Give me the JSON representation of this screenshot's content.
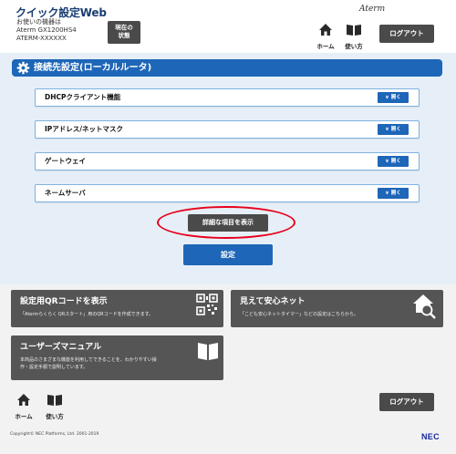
{
  "header": {
    "app_title": "クイック設定Web",
    "device_label": "お使いの機器は",
    "device_model": "Aterm GX1200HS4",
    "device_name": "ATERM-XXXXXX",
    "status_button_line1": "現在の",
    "status_button_line2": "状態",
    "logo": "Aterm",
    "home_label": "ホーム",
    "help_label": "使い方",
    "logout_label": "ログアウト"
  },
  "main": {
    "section_title": "接続先設定(ローカルルータ)",
    "open_label": "開く",
    "rows": [
      {
        "label": "DHCPクライアント機能"
      },
      {
        "label": "IPアドレス/ネットマスク"
      },
      {
        "label": "ゲートウェイ"
      },
      {
        "label": "ネームサーバ"
      }
    ],
    "detail_button": "詳細な項目を表示",
    "set_button": "設定"
  },
  "cards": {
    "qr": {
      "title": "設定用QRコードを表示",
      "desc": "「Atermらくらく QRスタート」用のQRコードを作成できます。",
      "icon": "qr-code-icon"
    },
    "safety": {
      "title": "見えて安心ネット",
      "desc": "「こども安心ネットタイマー」などの設定はこちらから。",
      "icon": "house-magnifier-icon"
    },
    "manual": {
      "title": "ユーザーズマニュアル",
      "desc_line1": "本商品のさまざまな機能を利用してできることを、わかりやすい操",
      "desc_line2": "作・設定手順で説明しています。",
      "icon": "book-icon"
    }
  },
  "footer": {
    "home_label": "ホーム",
    "help_label": "使い方",
    "logout_label": "ログアウト",
    "copyright": "Copyright© NEC Platforms, Ltd. 2001-2019",
    "brand": "NEC"
  },
  "colors": {
    "accent_blue": "#1e66b8",
    "dark_button": "#4a4a4a",
    "panel_bg": "#e6eff7",
    "highlight_red": "#e8001c"
  }
}
